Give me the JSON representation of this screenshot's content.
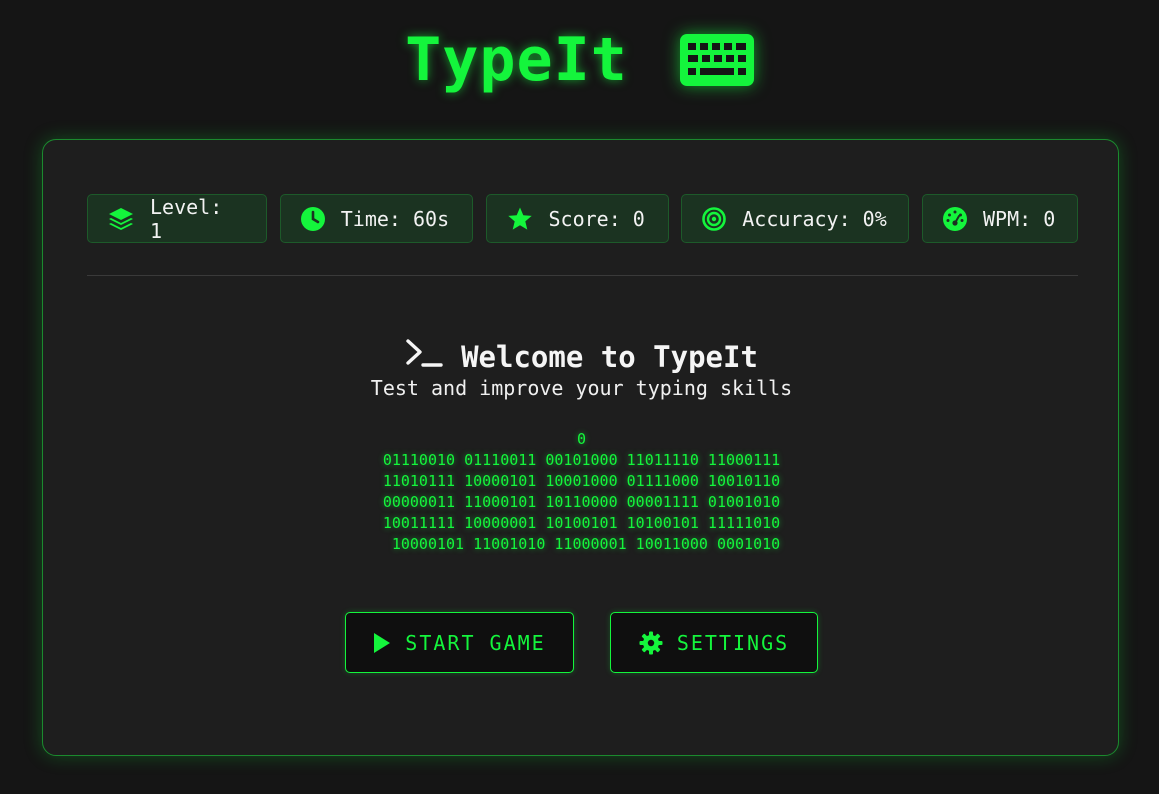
{
  "app": {
    "title": "TypeIt",
    "title_icon": "keyboard-icon",
    "accent_color": "#14f53c"
  },
  "stats": [
    {
      "icon": "layers-icon",
      "label": "Level: 1"
    },
    {
      "icon": "clock-icon",
      "label": "Time: 60s"
    },
    {
      "icon": "star-icon",
      "label": "Score: 0"
    },
    {
      "icon": "target-icon",
      "label": "Accuracy: 0%"
    },
    {
      "icon": "gauge-icon",
      "label": "WPM: 0"
    }
  ],
  "welcome": {
    "icon": "terminal-icon",
    "heading": "Welcome to TypeIt",
    "subtitle": "Test and improve your typing skills"
  },
  "binary_lines": [
    "0",
    "01110010 01110011 00101000 11011110 11000111",
    "11010111 10000101 10001000 01111000 10010110",
    "00000011 11000101 10110000 00001111 01001010",
    "10011111 10000001 10100101 10100101 11111010",
    " 10000101 11001010 11000001 10011000 0001010"
  ],
  "buttons": {
    "start_label": "START GAME",
    "start_icon": "play-icon",
    "settings_label": "SETTINGS",
    "settings_icon": "gear-icon"
  }
}
